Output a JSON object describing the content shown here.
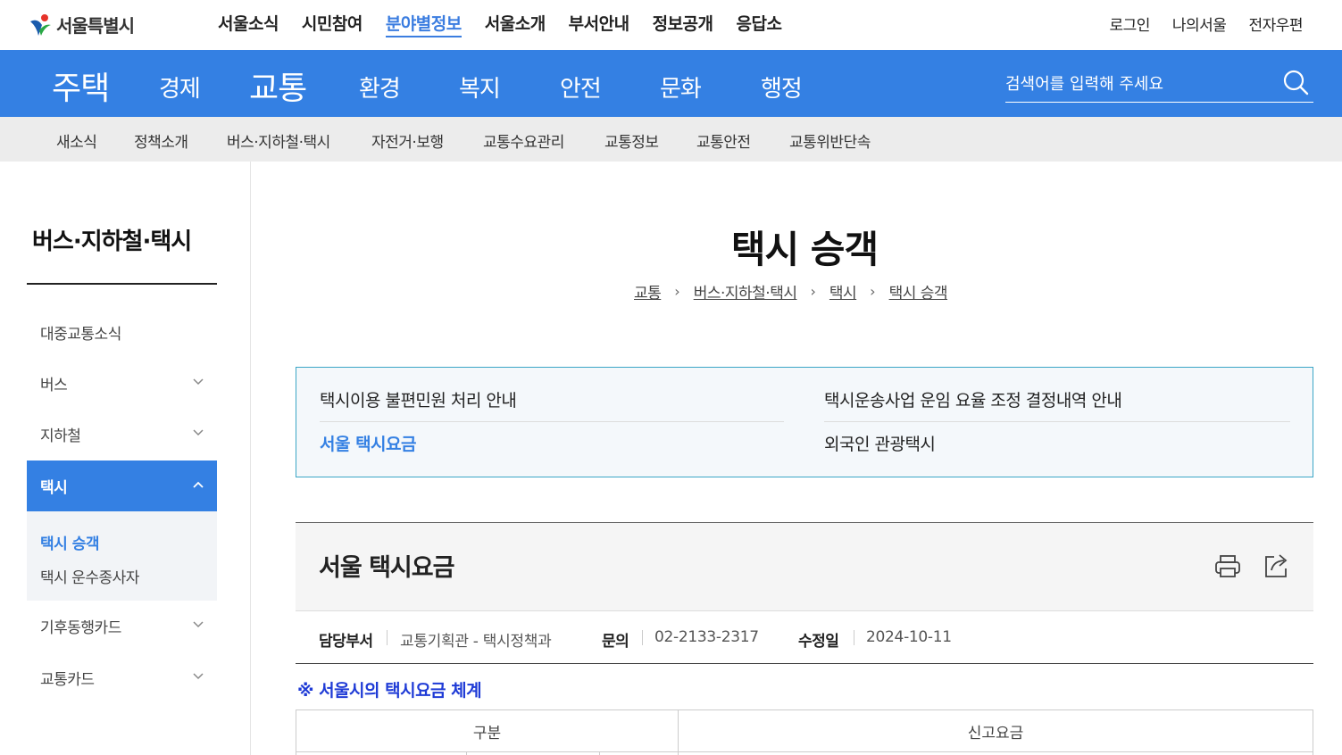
{
  "logo": {
    "text": "서울특별시",
    "icon": "seoul-logo-icon",
    "colors": {
      "red": "#e6332a",
      "blue": "#1b5cad",
      "green": "#2aa845"
    }
  },
  "gnb": {
    "items": [
      {
        "label": "서울소식",
        "active": false
      },
      {
        "label": "시민참여",
        "active": false
      },
      {
        "label": "분야별정보",
        "active": true
      },
      {
        "label": "서울소개",
        "active": false
      },
      {
        "label": "부서안내",
        "active": false
      },
      {
        "label": "정보공개",
        "active": false
      },
      {
        "label": "응답소",
        "active": false
      }
    ]
  },
  "util": {
    "login": "로그인",
    "my_seoul": "나의서울",
    "email": "전자우편"
  },
  "categories": [
    {
      "label": "주택",
      "large": true
    },
    {
      "label": "경제",
      "large": false
    },
    {
      "label": "교통",
      "large": true
    },
    {
      "label": "환경",
      "large": false
    },
    {
      "label": "복지",
      "large": false
    },
    {
      "label": "안전",
      "large": false
    },
    {
      "label": "문화",
      "large": false
    },
    {
      "label": "행정",
      "large": false
    }
  ],
  "search": {
    "placeholder": "검색어를 입력해 주세요",
    "icon": "search-icon"
  },
  "subnav": [
    "새소식",
    "정책소개",
    "버스·지하철·택시",
    "자전거·보행",
    "교통수요관리",
    "교통정보",
    "교통안전",
    "교통위반단속"
  ],
  "sidebar": {
    "title": "버스·지하철·택시",
    "items": [
      {
        "label": "대중교통소식",
        "chevron": false
      },
      {
        "label": "버스",
        "chevron": true
      },
      {
        "label": "지하철",
        "chevron": true
      },
      {
        "label": "택시",
        "chevron": true,
        "active": true
      },
      {
        "label": "기후동행카드",
        "chevron": true
      },
      {
        "label": "교통카드",
        "chevron": true
      }
    ],
    "sub_items": [
      {
        "label": "택시 승객",
        "active": true
      },
      {
        "label": "택시 운수종사자",
        "active": false
      }
    ]
  },
  "page": {
    "title": "택시 승객",
    "breadcrumb": [
      "교통",
      "버스·지하철·택시",
      "택시",
      "택시 승객"
    ]
  },
  "quick_links": [
    {
      "label": "택시이용 불편민원 처리 안내",
      "active": false
    },
    {
      "label": "택시운송사업 운임 요율 조정 결정내역 안내",
      "active": false
    },
    {
      "label": "서울 택시요금",
      "active": true
    },
    {
      "label": "외국인 관광택시",
      "active": false
    }
  ],
  "article": {
    "title": "서울 택시요금",
    "print_icon": "print-icon",
    "share_icon": "share-icon",
    "meta": {
      "dept_label": "담당부서",
      "dept_value": "교통기획관 - 택시정책과",
      "contact_label": "문의",
      "contact_value": "02-2133-2317",
      "modified_label": "수정일",
      "modified_value": "2024-10-11"
    },
    "section_heading": "※ 서울시의 택시요금 체계",
    "table": {
      "headers": [
        "구분",
        "신고요금"
      ]
    }
  },
  "colors": {
    "primary": "#3480e3",
    "accent_link": "#3b7de0",
    "section_heading": "#1f3bd6",
    "quick_border": "#3ba6c6"
  }
}
